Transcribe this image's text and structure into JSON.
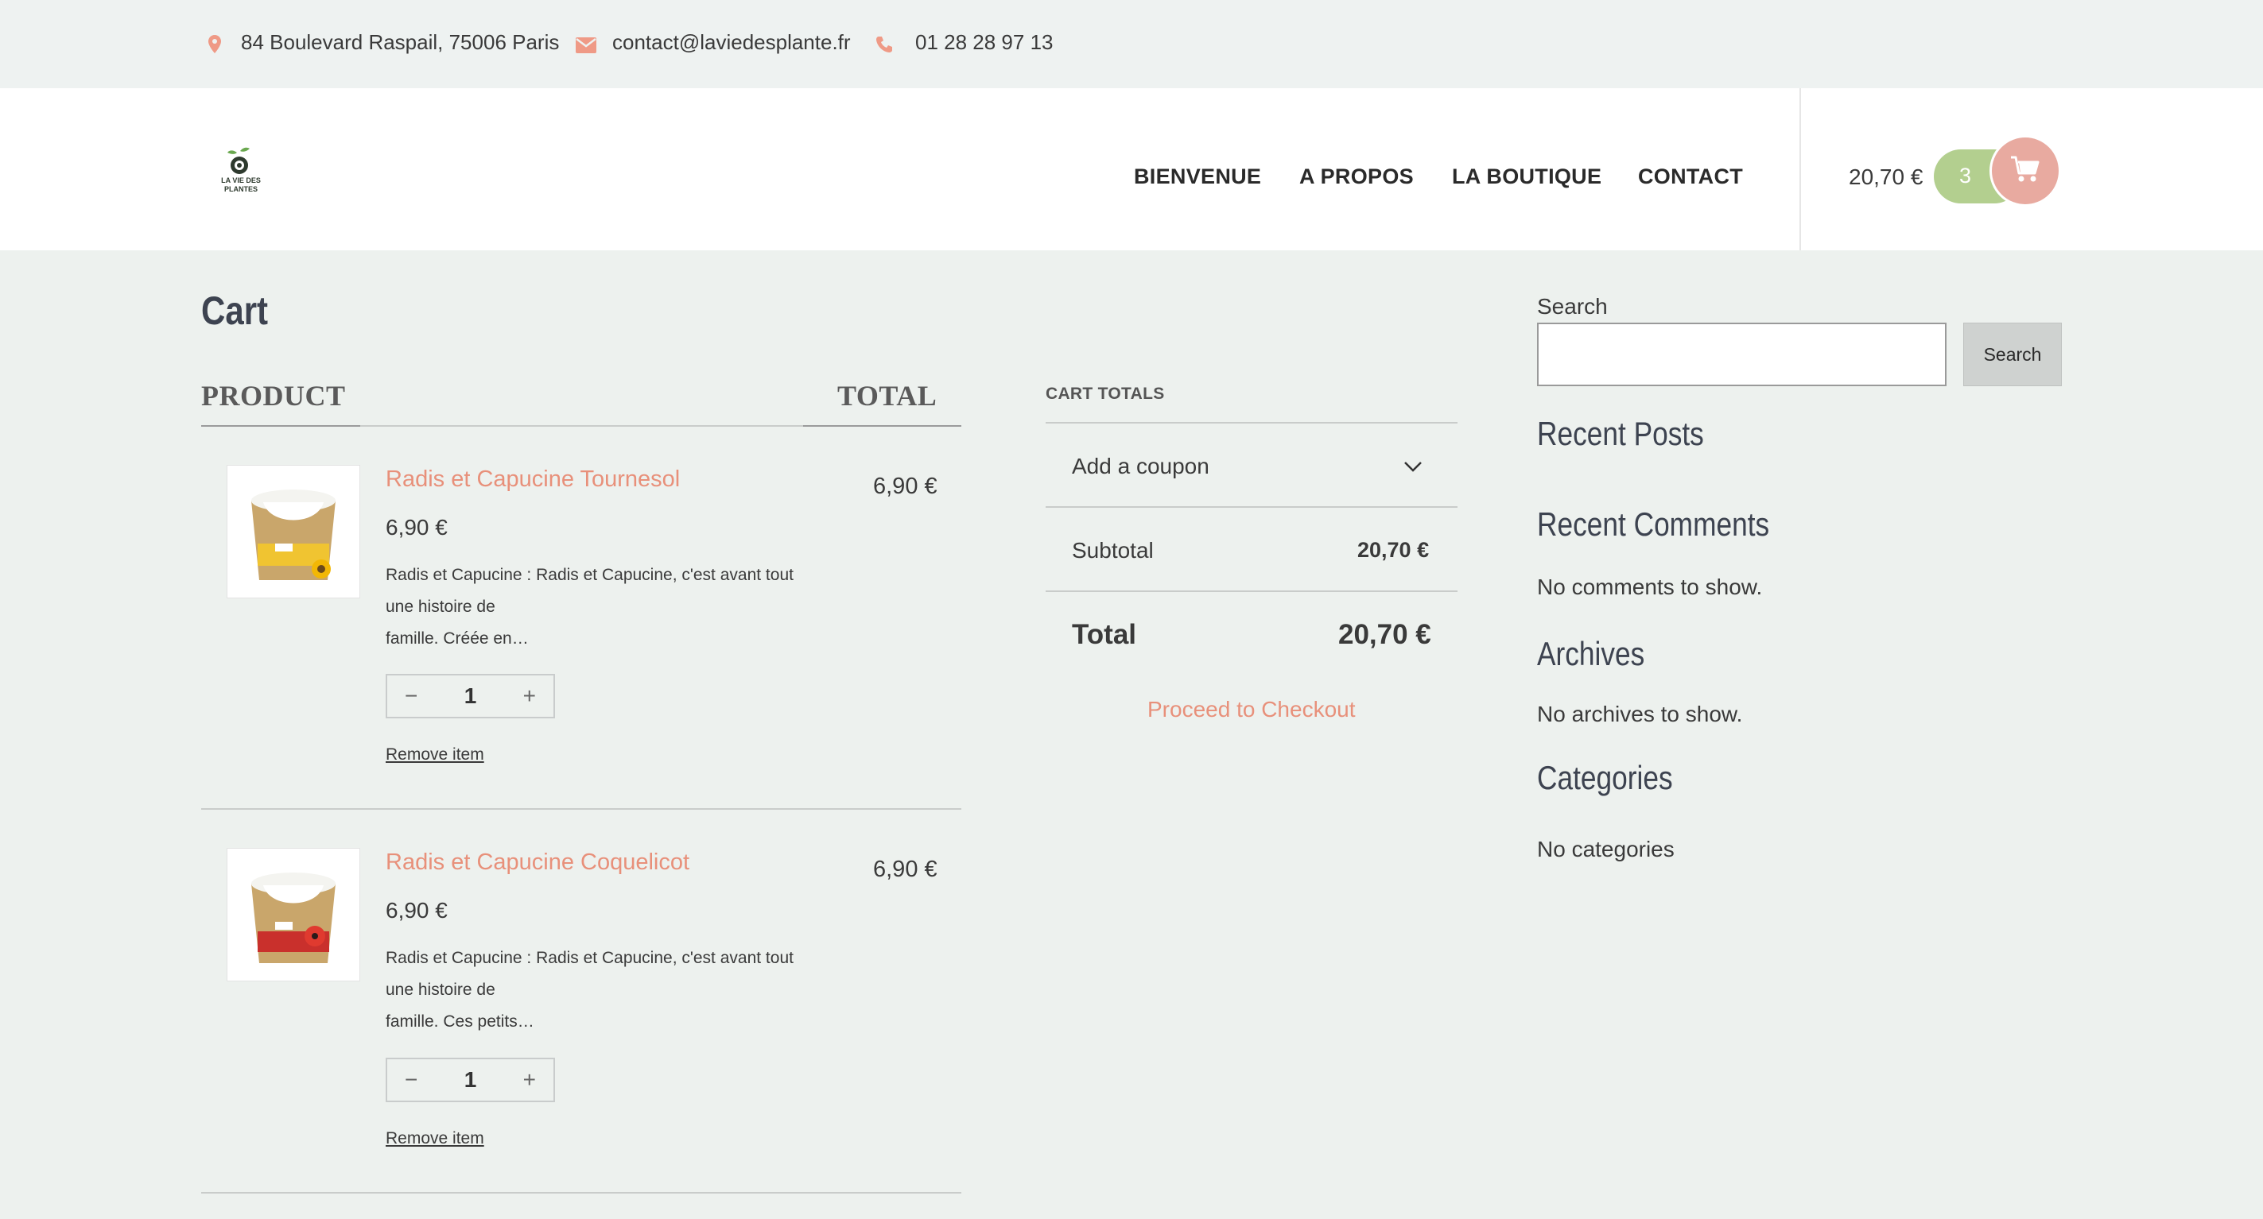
{
  "topbar": {
    "address": "84 Boulevard Raspail, 75006 Paris",
    "email": "contact@laviedesplante.fr",
    "phone": "01 28 28 97 13"
  },
  "brand": {
    "logo_line1": "LA VIE DES",
    "logo_line2": "PLANTES"
  },
  "nav": [
    "BIENVENUE",
    "A PROPOS",
    "LA BOUTIQUE",
    "CONTACT"
  ],
  "mini_cart": {
    "amount": "20,70 €",
    "count": "3"
  },
  "cart": {
    "title": "Cart",
    "col_product": "PRODUCT",
    "col_total": "TOTAL",
    "items": [
      {
        "name": "Radis et Capucine Tournesol",
        "price": "6,90 €",
        "desc_l1": "Radis et Capucine : Radis et Capucine, c'est avant tout",
        "desc_l2": "une histoire de",
        "desc_l3": "famille. Créée en…",
        "qty": "1",
        "total": "6,90 €",
        "remove": "Remove item"
      },
      {
        "name": "Radis et Capucine Coquelicot",
        "price": "6,90 €",
        "desc_l1": "Radis et Capucine : Radis et Capucine, c'est avant tout",
        "desc_l2": "une histoire de",
        "desc_l3": "famille. Ces petits…",
        "qty": "1",
        "total": "6,90 €",
        "remove": "Remove item"
      }
    ]
  },
  "totals": {
    "title": "CART TOTALS",
    "coupon": "Add a coupon",
    "subtotal_label": "Subtotal",
    "subtotal_value": "20,70 €",
    "total_label": "Total",
    "total_value": "20,70 €",
    "checkout": "Proceed to Checkout"
  },
  "sidebar": {
    "search_label": "Search",
    "search_button": "Search",
    "recent_posts": "Recent Posts",
    "recent_comments": "Recent Comments",
    "no_comments": "No comments to show.",
    "archives": "Archives",
    "no_archives": "No archives to show.",
    "categories": "Categories",
    "no_categories": "No categories"
  },
  "colors": {
    "accent": "#e8907a",
    "badge_green": "#b3cf8f",
    "cart_pink": "#e8aaa0",
    "bg": "#edf1ee"
  }
}
